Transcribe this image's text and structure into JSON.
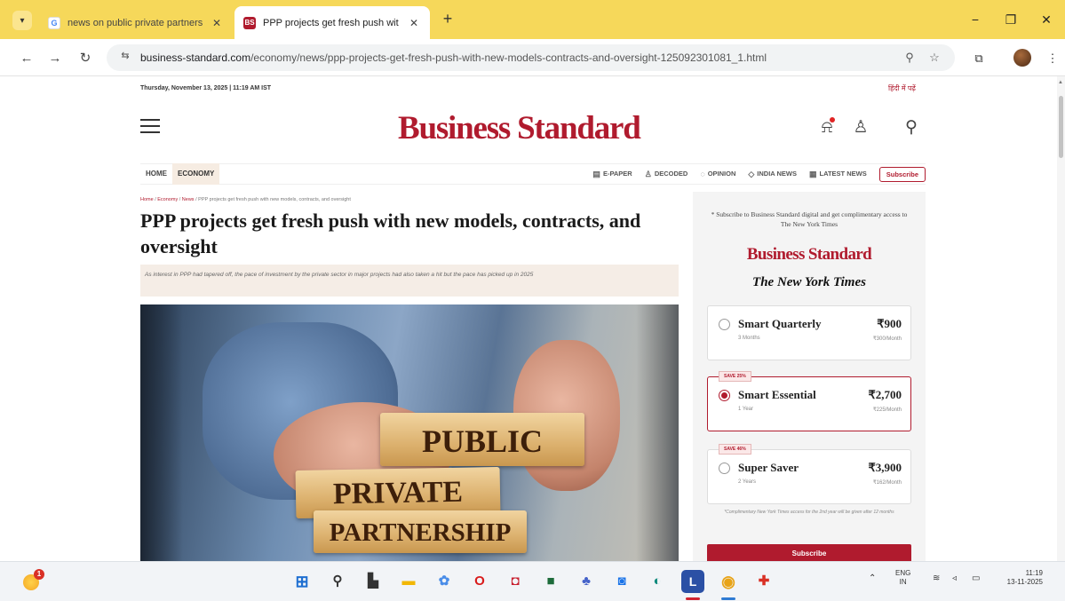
{
  "browser": {
    "tab_list_icon": "chevron-down-icon",
    "tabs": [
      {
        "title": "news on public private partners",
        "favicon": "G",
        "close": "✕"
      },
      {
        "title": "PPP projects get fresh push wit",
        "favicon": "BS",
        "close": "✕"
      }
    ],
    "new_tab": "+",
    "window_controls": {
      "minimize": "−",
      "restore": "❐",
      "close": "✕"
    },
    "address": {
      "host": "business-standard.com",
      "path": "/economy/news/ppp-projects-get-fresh-push-with-new-models-contracts-and-oversight-125092301081_1.html"
    }
  },
  "site": {
    "dateline": "Thursday, November 13, 2025 | 11:19 AM IST",
    "hindi_link": "हिंदी में पढ़ें",
    "logo": "Business Standard",
    "nav": {
      "left": [
        "HOME",
        "ECONOMY"
      ],
      "right": [
        {
          "label": "E-PAPER",
          "icon": "▤"
        },
        {
          "label": "DECODED",
          "icon": "♙"
        },
        {
          "label": "OPINION",
          "icon": "◌"
        },
        {
          "label": "INDIA NEWS",
          "icon": "◇"
        },
        {
          "label": "LATEST NEWS",
          "icon": "▦"
        }
      ],
      "subscribe": "Subscribe"
    }
  },
  "article": {
    "breadcrumb": {
      "items": [
        "Home",
        "Economy",
        "News"
      ],
      "current": "PPP projects get fresh push with new models, contracts, and oversight"
    },
    "headline": "PPP projects get fresh push with new models, contracts, and oversight",
    "summary": "As interest in PPP had tapered off, the pace of investment by the private sector in major projects had also taken a hit but the pace has picked up in 2025",
    "image_words": [
      "PUBLIC",
      "PRIVATE",
      "PARTNERSHIP"
    ]
  },
  "subscription": {
    "promo": "* Subscribe to Business Standard digital and get complimentary access to The New York Times",
    "logo_bs": "Business Standard",
    "logo_nyt": "The New York Times",
    "plans": [
      {
        "name": "Smart Quarterly",
        "term": "3 Months",
        "price": "₹900",
        "per_month": "₹300/Month",
        "badge": "",
        "selected": false
      },
      {
        "name": "Smart Essential",
        "term": "1 Year",
        "price": "₹2,700",
        "per_month": "₹225/Month",
        "badge": "SAVE 25%",
        "selected": true
      },
      {
        "name": "Super Saver",
        "term": "2 Years",
        "price": "₹3,900",
        "per_month": "₹162/Month",
        "badge": "SAVE 46%",
        "selected": false
      }
    ],
    "note": "*Complimentary New York Times access for the 2nd year will be given after 12 months",
    "subscribe_btn": "Subscribe"
  },
  "taskbar": {
    "widget_badge": "1",
    "tray": {
      "lang": "ENG",
      "region": "IN",
      "time": "11:19",
      "date": "13-11-2025"
    }
  },
  "colors": {
    "brand": "#b01b2e",
    "chrome": "#f6d85a",
    "taskbar": "#f2f4f7"
  }
}
